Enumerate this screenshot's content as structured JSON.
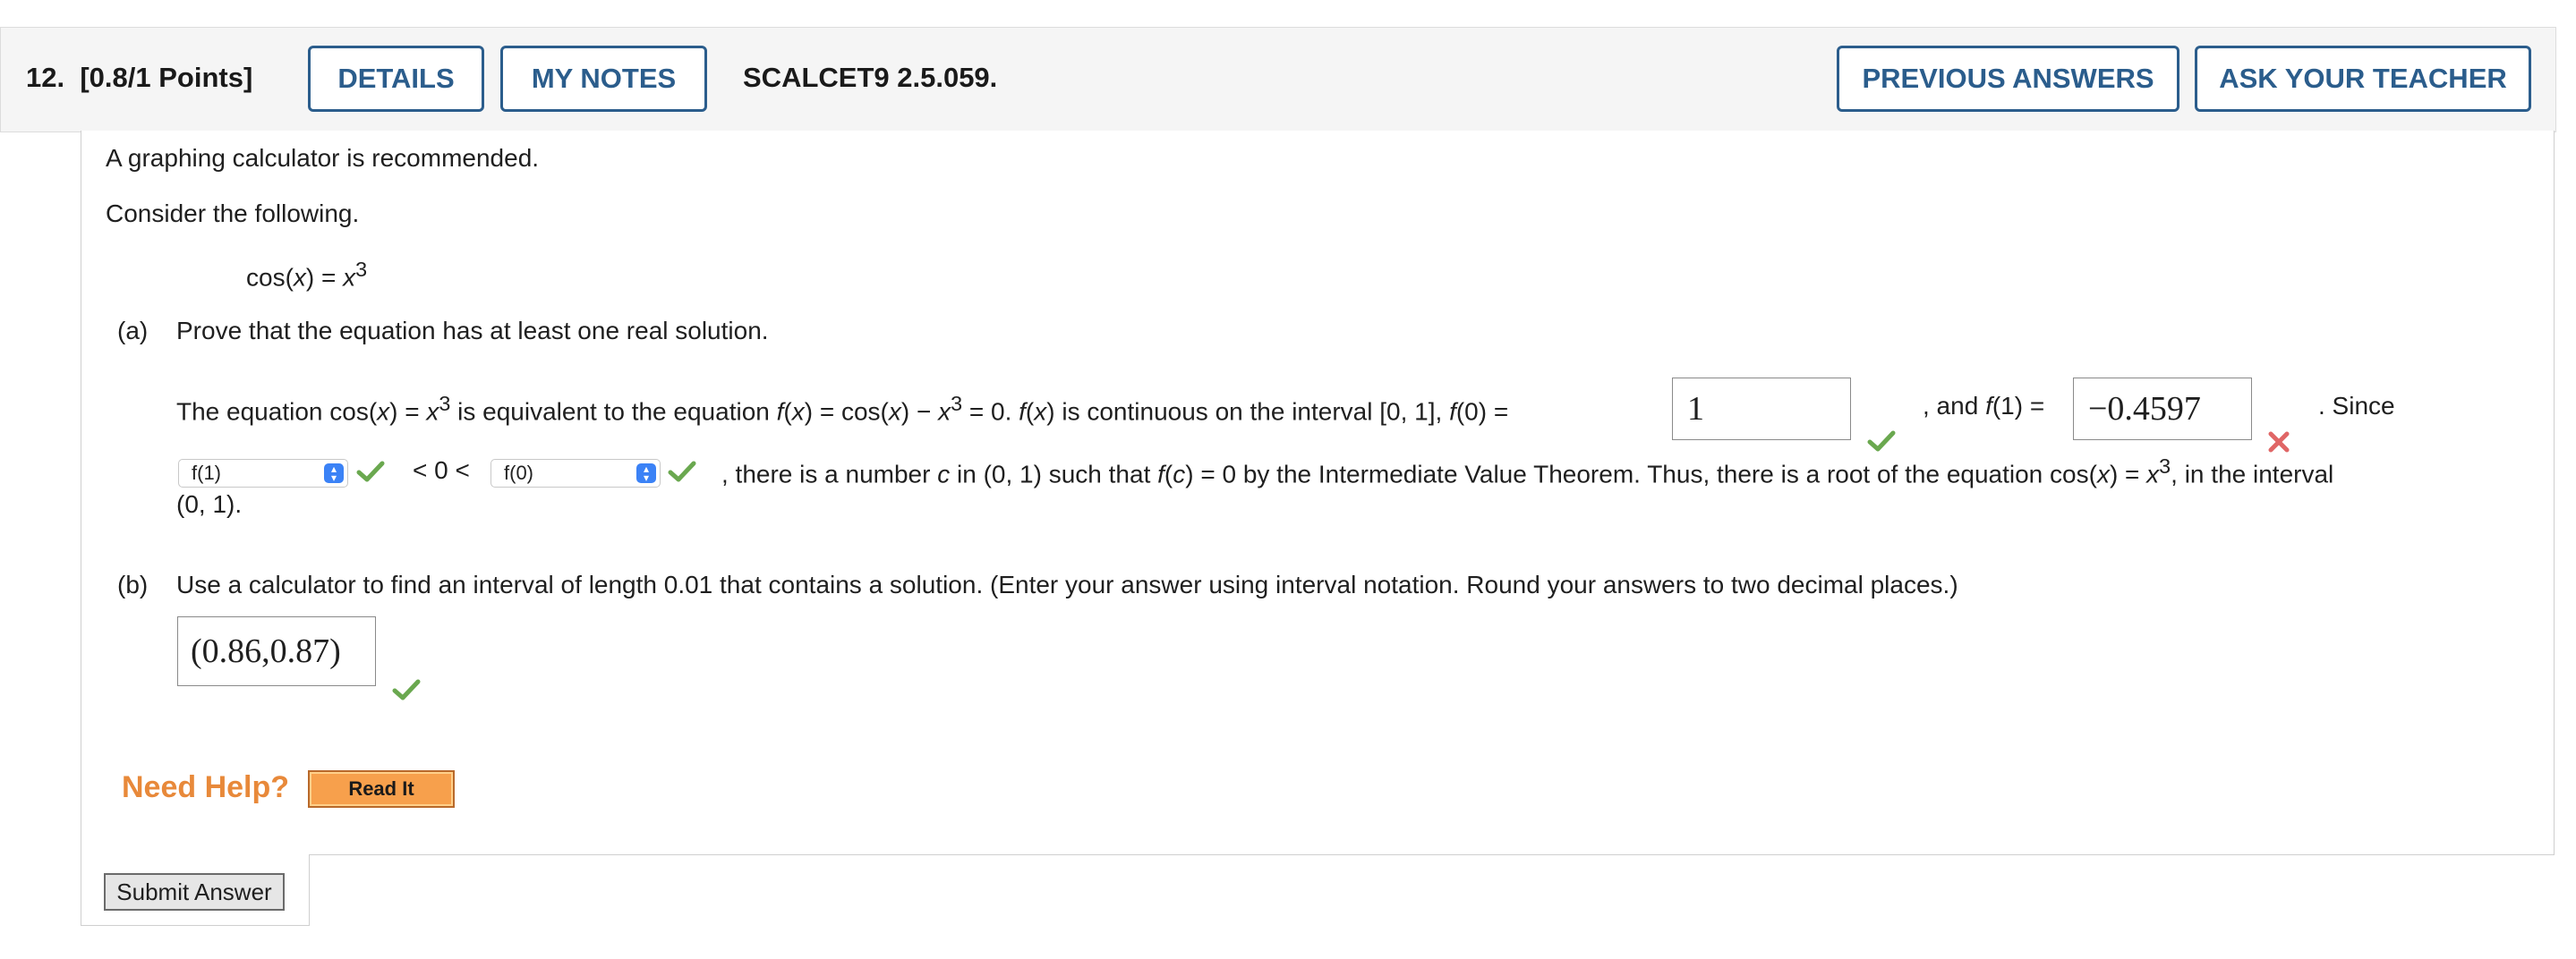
{
  "header": {
    "question_number": "12.",
    "points": "[0.8/1 Points]",
    "details_label": "DETAILS",
    "my_notes_label": "MY NOTES",
    "reference": "SCALCET9 2.5.059.",
    "previous_answers_label": "PREVIOUS ANSWERS",
    "ask_teacher_label": "ASK YOUR TEACHER"
  },
  "intro": {
    "calculator_note": "A graphing calculator is recommended.",
    "consider": "Consider the following."
  },
  "equation": {
    "lhs": "cos(",
    "var": "x",
    "mid": ") = ",
    "base": "x",
    "exp": "3"
  },
  "part_a": {
    "label": "(a)",
    "prompt": "Prove that the equation has at least one real solution.",
    "t1": "The equation cos(",
    "t2": "x",
    "t3": ") = ",
    "t4": "x",
    "t5": "3",
    "t6": " is equivalent to the equation ",
    "t7": "f",
    "t8": "(",
    "t9": "x",
    "t10": ") = cos(",
    "t11": "x",
    "t12": ") − ",
    "t13": "x",
    "t14": "3",
    "t15": " = 0. ",
    "t16": "f",
    "t17": "(",
    "t18": "x",
    "t19": ") is continuous on the interval [0, 1], ",
    "t20": "f",
    "t21": "(0) =",
    "f0_answer": "1",
    "and_text": ", and ",
    "and_f": "f",
    "and_rest": "(1) =",
    "f1_answer": "−0.4597",
    "since_text": ". Since",
    "select1_value": "f(1)",
    "ineq_text": "< 0 <",
    "select2_value": "f(0)",
    "s1": ", there is a number ",
    "s2": "c",
    "s3": " in (0, 1) such that ",
    "s4": "f",
    "s5": "(",
    "s6": "c",
    "s7": ") = 0 by the Intermediate Value Theorem. Thus, there is a root of the equation cos(",
    "s8": "x",
    "s9": ") = ",
    "s10": "x",
    "s11": "3",
    "s12": ", in the interval",
    "interval_end": "(0, 1)."
  },
  "part_b": {
    "label": "(b)",
    "prompt": "Use a calculator to find an interval of length 0.01 that contains a solution. (Enter your answer using interval notation. Round your answers to two decimal places.)",
    "answer": "(0.86,0.87)"
  },
  "help": {
    "need_help": "Need Help?",
    "read_it_label": "Read It"
  },
  "submit": {
    "label": "Submit Answer"
  },
  "colors": {
    "accent": "#2b5d8c",
    "correct": "#6aa84f",
    "incorrect": "#e06666",
    "help": "#e8893a"
  },
  "icons": {
    "correct": "check-icon",
    "incorrect": "cross-icon",
    "select_arrow": "updown-chevron-icon"
  }
}
